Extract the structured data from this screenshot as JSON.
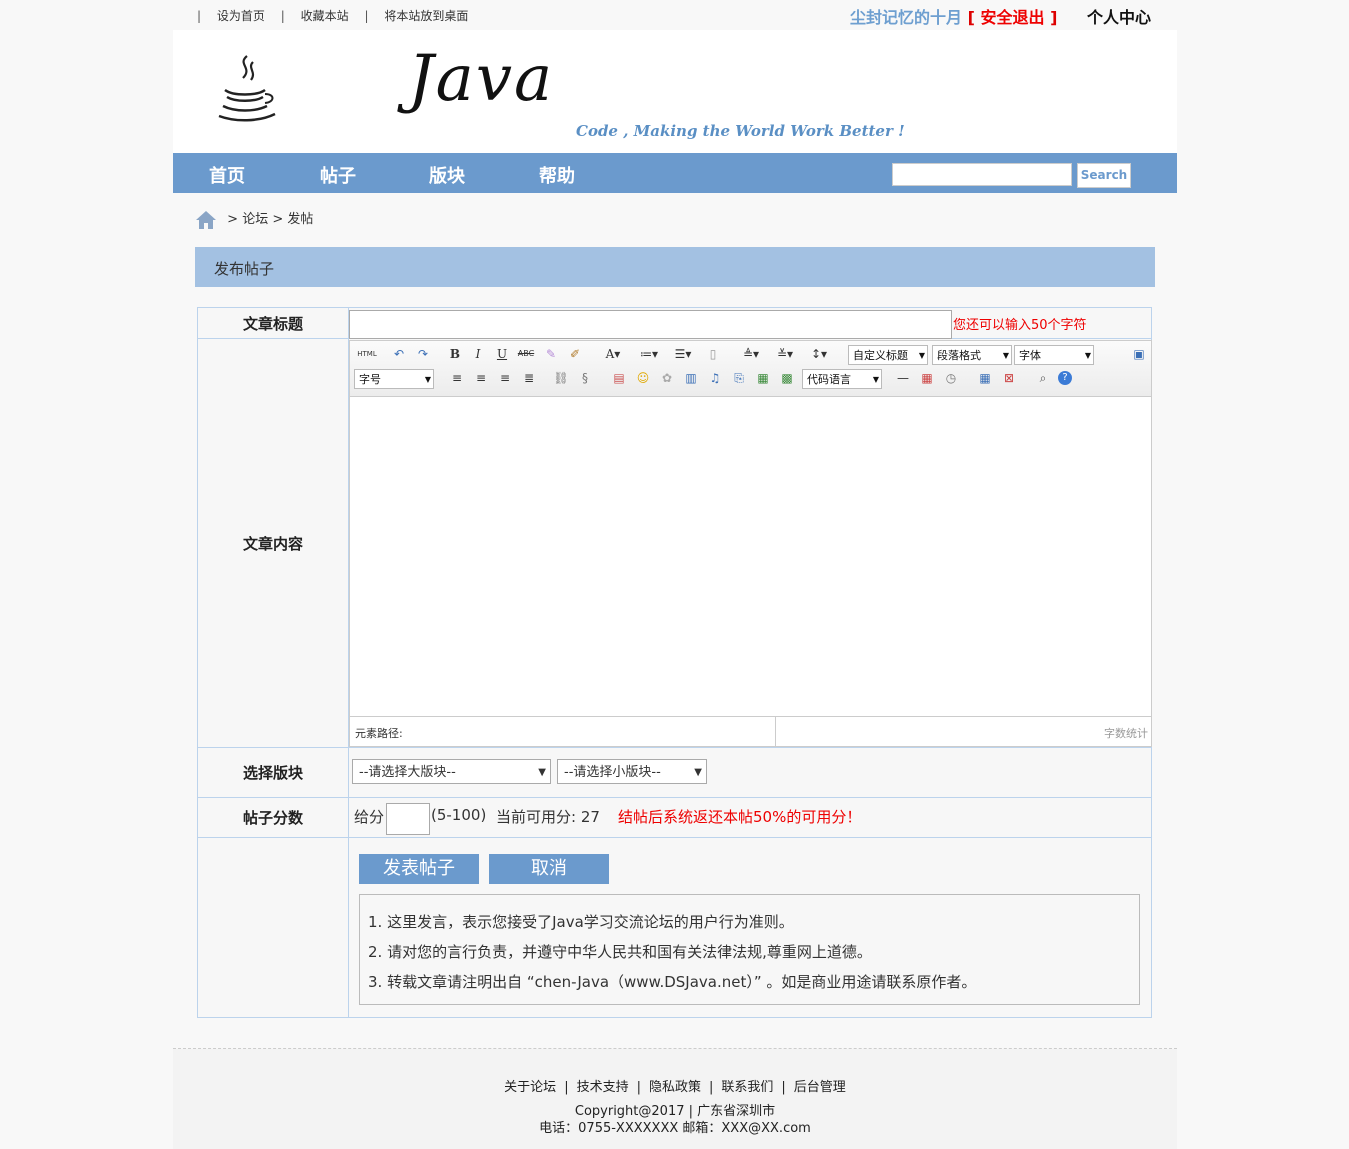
{
  "topbar": {
    "links": [
      "设为首页",
      "收藏本站",
      "将本站放到桌面"
    ],
    "username": "尘封记忆的十月",
    "logout": "安全退出",
    "center": "个人中心"
  },
  "header": {
    "logo_text": "Java",
    "slogan": "Code , Making the World Work Better !"
  },
  "nav": {
    "items": [
      "首页",
      "帖子",
      "版块",
      "帮助"
    ],
    "search_placeholder": "",
    "search_button": "Search"
  },
  "breadcrumb": {
    "forum": "论坛",
    "post": "发帖",
    "sep": ">"
  },
  "panel": {
    "title": "发布帖子"
  },
  "form": {
    "title_label": "文章标题",
    "title_value": "",
    "title_hint": "您还可以输入50个字符",
    "content_label": "文章内容",
    "board_label": "选择版块",
    "big_board": "--请选择大版块--",
    "small_board": "--请选择小版块--",
    "score_label": "帖子分数",
    "score_give": "给分",
    "score_value": "",
    "score_range": "(5-100)",
    "score_avail": "当前可用分: 27",
    "score_tip": "结帖后系统返还本帖50%的可用分！",
    "submit": "发表帖子",
    "cancel": "取消",
    "notes": [
      "1. 这里发言，表示您接受了Java学习交流论坛的用户行为准则。",
      "2. 请对您的言行负责，并遵守中华人民共和国有关法律法规,尊重网上道德。",
      "3. 转载文章请注明出自 “chen-Java（www.DSJava.net）” 。如是商业用途请联系原作者。"
    ]
  },
  "editor": {
    "selects": {
      "custom_title": "自定义标题",
      "paragraph": "段落格式",
      "font": "字体",
      "font_size": "字号",
      "code_lang": "代码语言"
    },
    "status_path": "元素路径:",
    "word_count": "字数统计",
    "html_label": "HTML"
  },
  "footer": {
    "links": [
      "关于论坛",
      "技术支持",
      "隐私政策",
      "联系我们",
      "后台管理"
    ],
    "copyright": "Copyright@2017 | 广东省深圳市",
    "contact": "电话：0755-XXXXXXX 邮箱：XXX@XX.com"
  },
  "colors": {
    "nav": "#6b9acd",
    "panel": "#a3c1e2",
    "alert": "#e00000"
  }
}
